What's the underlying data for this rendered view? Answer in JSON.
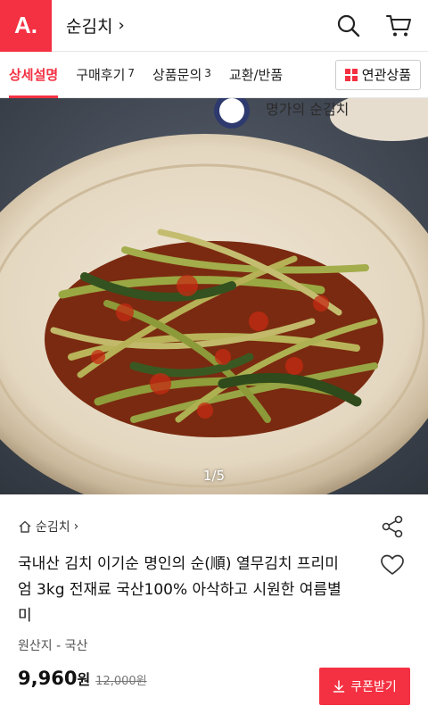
{
  "header": {
    "logo_text": "A.",
    "shop_name": "순김치",
    "chevron": "›",
    "icons": [
      "search-icon",
      "cart-icon"
    ]
  },
  "tabs": [
    {
      "label": "상세설명",
      "count": ""
    },
    {
      "label": "구매후기",
      "count": "7"
    },
    {
      "label": "상품문의",
      "count": "3"
    },
    {
      "label": "교환/반품",
      "count": ""
    }
  ],
  "related_button": {
    "label": "연관상품"
  },
  "hero": {
    "brand_overlay": "명가의 순김치",
    "counter": "1/5"
  },
  "product": {
    "breadcrumb": "순김치",
    "title": "국내산 김치 이기순 명인의 순(順) 열무김치 프리미엄 3kg 전재료 국산100% 아삭하고 시원한 여름별미",
    "origin": "원산지 - 국산",
    "price": "9,960",
    "price_unit": "원",
    "original_price": "12,000원",
    "coupon_label": "쿠폰받기"
  },
  "colors": {
    "accent": "#f43142"
  }
}
